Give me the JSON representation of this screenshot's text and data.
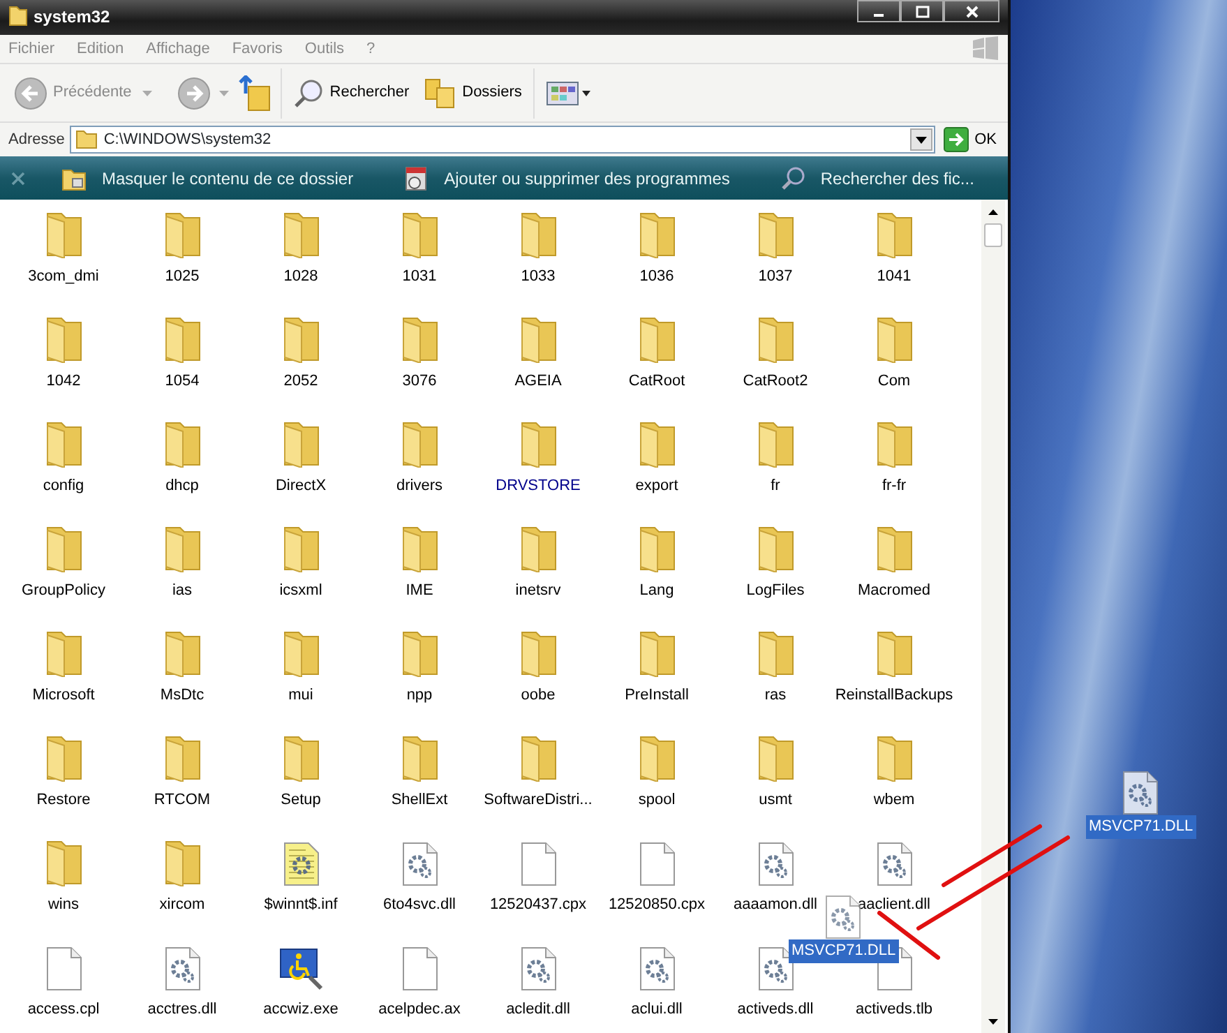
{
  "window": {
    "title": "system32"
  },
  "menu": [
    "Fichier",
    "Edition",
    "Affichage",
    "Favoris",
    "Outils",
    "?"
  ],
  "toolbar": {
    "back": "Précédente",
    "search": "Rechercher",
    "folders": "Dossiers"
  },
  "address": {
    "label": "Adresse",
    "value": "C:\\WINDOWS\\system32",
    "go": "OK"
  },
  "tasks": [
    {
      "label": "Masquer le contenu de ce dossier",
      "kind": "hide"
    },
    {
      "label": "Ajouter ou supprimer des programmes",
      "kind": "programs"
    },
    {
      "label": "Rechercher des fic...",
      "kind": "search"
    }
  ],
  "items": [
    {
      "name": "3com_dmi",
      "kind": "folder",
      "compressed": false
    },
    {
      "name": "1025",
      "kind": "folder",
      "compressed": false
    },
    {
      "name": "1028",
      "kind": "folder",
      "compressed": false
    },
    {
      "name": "1031",
      "kind": "folder",
      "compressed": false
    },
    {
      "name": "1033",
      "kind": "folder",
      "compressed": false
    },
    {
      "name": "1036",
      "kind": "folder",
      "compressed": false
    },
    {
      "name": "1037",
      "kind": "folder",
      "compressed": false
    },
    {
      "name": "1041",
      "kind": "folder",
      "compressed": false
    },
    {
      "name": "1042",
      "kind": "folder",
      "compressed": false
    },
    {
      "name": "1054",
      "kind": "folder",
      "compressed": false
    },
    {
      "name": "2052",
      "kind": "folder",
      "compressed": false
    },
    {
      "name": "3076",
      "kind": "folder",
      "compressed": false
    },
    {
      "name": "AGEIA",
      "kind": "folder",
      "compressed": false
    },
    {
      "name": "CatRoot",
      "kind": "folder",
      "compressed": false
    },
    {
      "name": "CatRoot2",
      "kind": "folder",
      "compressed": false
    },
    {
      "name": "Com",
      "kind": "folder",
      "compressed": false
    },
    {
      "name": "config",
      "kind": "folder",
      "compressed": false
    },
    {
      "name": "dhcp",
      "kind": "folder",
      "compressed": false
    },
    {
      "name": "DirectX",
      "kind": "folder",
      "compressed": false
    },
    {
      "name": "drivers",
      "kind": "folder",
      "compressed": false
    },
    {
      "name": "DRVSTORE",
      "kind": "folder",
      "compressed": true
    },
    {
      "name": "export",
      "kind": "folder",
      "compressed": false
    },
    {
      "name": "fr",
      "kind": "folder",
      "compressed": false
    },
    {
      "name": "fr-fr",
      "kind": "folder",
      "compressed": false
    },
    {
      "name": "GroupPolicy",
      "kind": "folder",
      "compressed": false
    },
    {
      "name": "ias",
      "kind": "folder",
      "compressed": false
    },
    {
      "name": "icsxml",
      "kind": "folder",
      "compressed": false
    },
    {
      "name": "IME",
      "kind": "folder",
      "compressed": false
    },
    {
      "name": "inetsrv",
      "kind": "folder",
      "compressed": false
    },
    {
      "name": "Lang",
      "kind": "folder",
      "compressed": false
    },
    {
      "name": "LogFiles",
      "kind": "folder",
      "compressed": false
    },
    {
      "name": "Macromed",
      "kind": "folder",
      "compressed": false
    },
    {
      "name": "Microsoft",
      "kind": "folder",
      "compressed": false
    },
    {
      "name": "MsDtc",
      "kind": "folder",
      "compressed": false
    },
    {
      "name": "mui",
      "kind": "folder",
      "compressed": false
    },
    {
      "name": "npp",
      "kind": "folder",
      "compressed": false
    },
    {
      "name": "oobe",
      "kind": "folder",
      "compressed": false
    },
    {
      "name": "PreInstall",
      "kind": "folder",
      "compressed": false
    },
    {
      "name": "ras",
      "kind": "folder",
      "compressed": false
    },
    {
      "name": "ReinstallBackups",
      "kind": "folder",
      "compressed": false
    },
    {
      "name": "Restore",
      "kind": "folder",
      "compressed": false
    },
    {
      "name": "RTCOM",
      "kind": "folder",
      "compressed": false
    },
    {
      "name": "Setup",
      "kind": "folder",
      "compressed": false
    },
    {
      "name": "ShellExt",
      "kind": "folder",
      "compressed": false
    },
    {
      "name": "SoftwareDistri...",
      "kind": "folder",
      "compressed": false
    },
    {
      "name": "spool",
      "kind": "folder",
      "compressed": false
    },
    {
      "name": "usmt",
      "kind": "folder",
      "compressed": false
    },
    {
      "name": "wbem",
      "kind": "folder",
      "compressed": false
    },
    {
      "name": "wins",
      "kind": "folder",
      "compressed": false
    },
    {
      "name": "xircom",
      "kind": "folder",
      "compressed": false
    },
    {
      "name": "$winnt$.inf",
      "kind": "inf",
      "compressed": false
    },
    {
      "name": "6to4svc.dll",
      "kind": "dll",
      "compressed": false
    },
    {
      "name": "12520437.cpx",
      "kind": "file",
      "compressed": false
    },
    {
      "name": "12520850.cpx",
      "kind": "file",
      "compressed": false
    },
    {
      "name": "aaaamon.dll",
      "kind": "dll",
      "compressed": false
    },
    {
      "name": "aaclient.dll",
      "kind": "dll",
      "compressed": false
    },
    {
      "name": "access.cpl",
      "kind": "file",
      "compressed": false
    },
    {
      "name": "acctres.dll",
      "kind": "dll",
      "compressed": false
    },
    {
      "name": "accwiz.exe",
      "kind": "exe",
      "compressed": false
    },
    {
      "name": "acelpdec.ax",
      "kind": "file",
      "compressed": false
    },
    {
      "name": "acledit.dll",
      "kind": "dll",
      "compressed": false
    },
    {
      "name": "aclui.dll",
      "kind": "dll",
      "compressed": false
    },
    {
      "name": "activeds.dll",
      "kind": "dll",
      "compressed": false
    },
    {
      "name": "activeds.tlb",
      "kind": "file",
      "compressed": false
    }
  ],
  "drag_ghost": {
    "label": "MSVCP71.DLL",
    "kind": "dll",
    "selected": true
  },
  "desktop": {
    "icons": [
      {
        "label": "MSVCP71.DLL",
        "kind": "dll",
        "selected": true
      }
    ]
  }
}
